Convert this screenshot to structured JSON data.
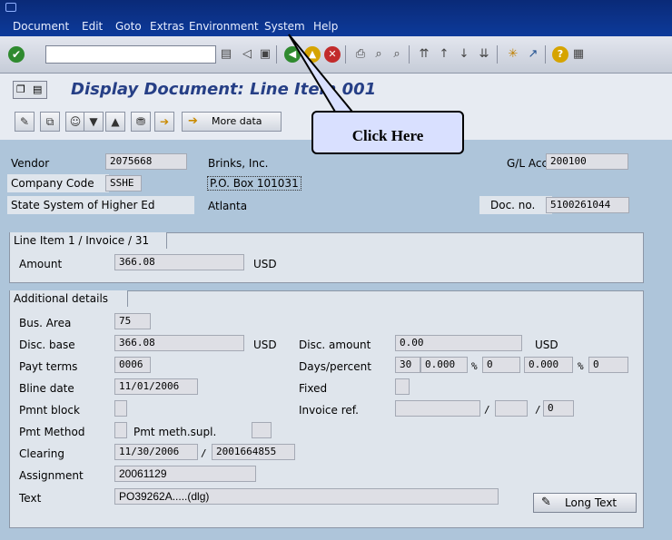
{
  "menubar": {
    "items": [
      {
        "label": "Document"
      },
      {
        "label": "Edit"
      },
      {
        "label": "Goto"
      },
      {
        "label": "Extras"
      },
      {
        "label": "Environment"
      },
      {
        "label": "System"
      },
      {
        "label": "Help"
      }
    ]
  },
  "toolbar": {
    "command_field_value": "",
    "icons": [
      "enter-icon",
      "save-icon",
      "back-icon",
      "exit-icon",
      "cancel-icon",
      "print-icon",
      "find-icon",
      "find-next-icon",
      "first-page-icon",
      "prev-page-icon",
      "next-page-icon",
      "last-page-icon",
      "create-session-icon",
      "shortcut-icon",
      "help-icon",
      "layout-icon"
    ]
  },
  "title": {
    "text": "Display Document: Line Item 001"
  },
  "app_toolbar": {
    "more_data_label": "More data"
  },
  "callout": {
    "text": "Click Here"
  },
  "header": {
    "vendor_label": "Vendor",
    "vendor_value": "2075668",
    "vendor_name": "Brinks, Inc.",
    "glacc_label": "G/L Acc",
    "glacc_value": "200100",
    "company_code_label": "Company Code",
    "company_code_value": "SSHE",
    "po_box": "P.O. Box 101031",
    "state_system": "State System of Higher Ed",
    "city": "Atlanta",
    "doc_no_label": "Doc. no.",
    "doc_no_value": "5100261044"
  },
  "line_item": {
    "tab_label": "Line Item 1 / Invoice / 31",
    "amount_label": "Amount",
    "amount_value": "366.08",
    "currency": "USD"
  },
  "additional": {
    "tab_label": "Additional details",
    "bus_area_label": "Bus. Area",
    "bus_area_value": "75",
    "disc_base_label": "Disc. base",
    "disc_base_value": "366.08",
    "disc_base_currency": "USD",
    "disc_amount_label": "Disc. amount",
    "disc_amount_value": "0.00",
    "disc_amount_currency": "USD",
    "payt_terms_label": "Payt terms",
    "payt_terms_value": "0006",
    "days_percent_label": "Days/percent",
    "days1": "30",
    "pct1": "0.000",
    "pct_sign1": "%",
    "days2": "0",
    "pct2": "0.000",
    "pct_sign2": "%",
    "days3": "0",
    "bline_date_label": "Bline date",
    "bline_date_value": "11/01/2006",
    "fixed_label": "Fixed",
    "pmnt_block_label": "Pmnt block",
    "invoice_ref_label": "Invoice ref.",
    "invoice_ref_sep1": "/",
    "invoice_ref_sep2": "/",
    "invoice_ref_value3": "0",
    "pmt_method_label": "Pmt Method",
    "pmt_meth_supl_label": "Pmt meth.supl.",
    "clearing_label": "Clearing",
    "clearing_date": "11/30/2006",
    "clearing_sep": "/",
    "clearing_doc": "2001664855",
    "assignment_label": "Assignment",
    "assignment_value": "20061129",
    "text_label": "Text",
    "text_value": "PO39262A.....(dlg)",
    "long_text_label": "Long Text"
  }
}
